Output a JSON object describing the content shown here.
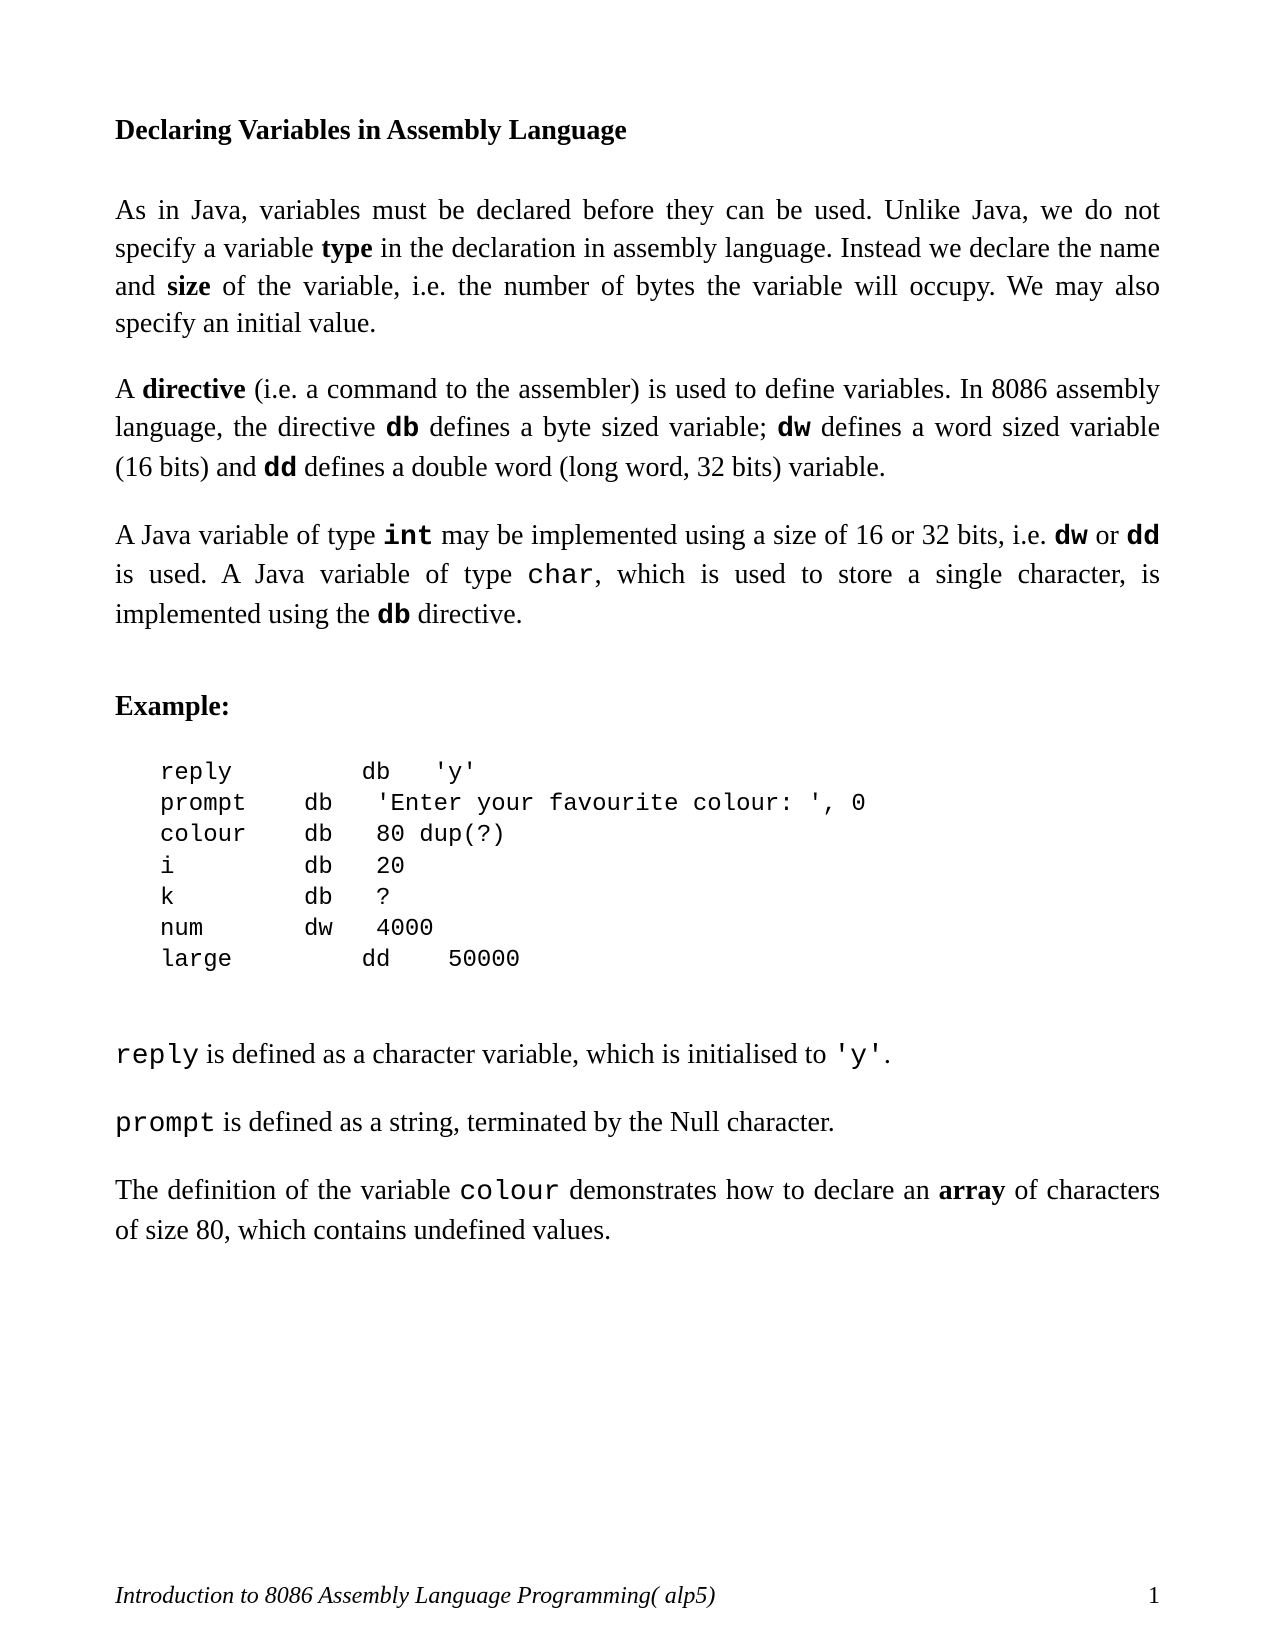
{
  "heading": "Declaring Variables in Assembly Language",
  "para1_part1": "As in Java, variables must be declared before they can be used. Unlike Java, we do not specify a variable ",
  "para1_bold1": "type",
  "para1_part2": " in the declaration in assembly language. Instead we declare the name and ",
  "para1_bold2": "size",
  "para1_part3": " of the variable, i.e. the number of bytes the variable will occupy. We may also specify an initial value.",
  "para2_part1": "A ",
  "para2_bold1": "directive",
  "para2_part2": " (i.e. a command to the assembler) is used to define variables. In 8086 assembly language, the directive ",
  "para2_code1": "db",
  "para2_part3": " defines a byte sized variable;  ",
  "para2_code2": "dw",
  "para2_part4": " defines a word sized variable (16 bits) and  ",
  "para2_code3": "dd",
  "para2_part5": " defines a double word (long word, 32 bits) variable.",
  "para3_part1": "A Java variable of type ",
  "para3_code1": "int",
  "para3_part2": " may be implemented using a size of 16 or 32 bits, i.e. ",
  "para3_code2": "dw",
  "para3_part3": " or ",
  "para3_code3": "dd",
  "para3_part4": " is  used. A Java variable of type ",
  "para3_code4": "char",
  "para3_part5": ", which is used to store a single character, is implemented using the ",
  "para3_code5": "db",
  "para3_part6": " directive.",
  "example_label": "Example:",
  "code_block": "reply         db   'y'\nprompt    db   'Enter your favourite colour: ', 0\ncolour    db   80 dup(?)\ni         db   20\nk         db   ?\nnum       dw   4000\nlarge         dd    50000",
  "para4_code1": "reply",
  "para4_part1": " is defined as a character variable, which is initialised to ",
  "para4_code2": "'y'",
  "para4_part2": ".",
  "para5_code1": "prompt",
  "para5_part1": " is defined as a string, terminated by the Null character.",
  "para6_part1": "The definition of the variable ",
  "para6_code1": "colour",
  "para6_part2": " demonstrates how to declare an ",
  "para6_bold1": "array",
  "para6_part3": " of characters of size 80, which contains undefined values.",
  "footer_title": "Introduction to 8086 Assembly Language Programming( alp5)",
  "page_number": "1"
}
